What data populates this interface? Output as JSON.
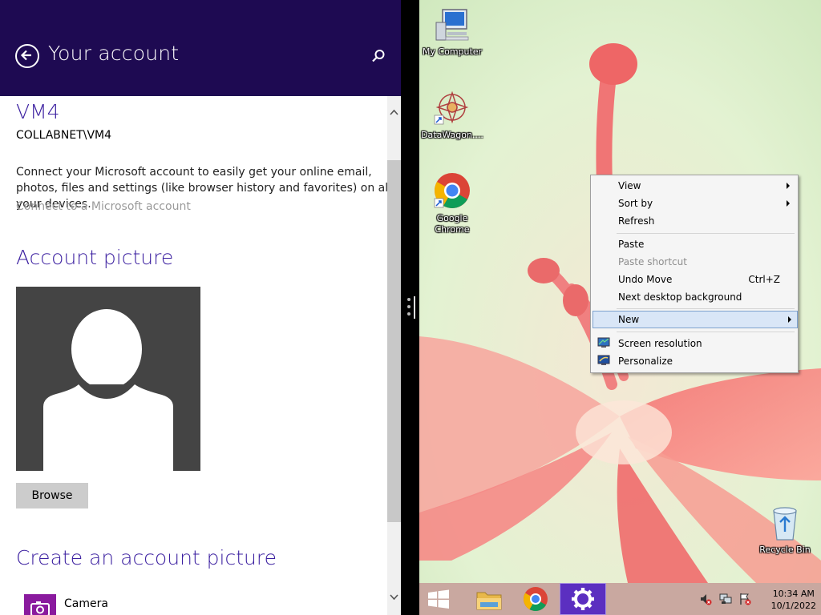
{
  "settings": {
    "title": "Your account",
    "user": {
      "name": "VM4",
      "domain": "COLLABNET\\VM4"
    },
    "description": "Connect your Microsoft account to easily get your online email, photos, files and settings (like browser history and favorites) on all your devices.",
    "connect_link": "Connect to a Microsoft account",
    "account_picture_heading": "Account picture",
    "browse_label": "Browse",
    "create_heading": "Create an account picture",
    "camera_label": "Camera",
    "accent": "#1e0a52",
    "heading_color": "#3b1fa0"
  },
  "desktop": {
    "icons": [
      {
        "label": "My Computer",
        "icon": "computer-icon"
      },
      {
        "label": "DataWagon....",
        "icon": "datawagon-shortcut-icon"
      },
      {
        "label": "Google Chrome",
        "icon": "chrome-shortcut-icon"
      },
      {
        "label": "Recycle Bin",
        "icon": "recycle-bin-icon"
      }
    ],
    "context_menu": {
      "view": "View",
      "sort_by": "Sort by",
      "refresh": "Refresh",
      "paste": "Paste",
      "paste_shortcut": "Paste shortcut",
      "undo_move": "Undo Move",
      "undo_shortcut": "Ctrl+Z",
      "next_background": "Next desktop background",
      "new": "New",
      "screen_resolution": "Screen resolution",
      "personalize": "Personalize"
    }
  },
  "taskbar": {
    "items": [
      "start-icon",
      "file-explorer-icon",
      "chrome-icon",
      "settings-icon"
    ],
    "tray_icons": [
      "volume-muted-icon",
      "network-icon",
      "action-center-flag-icon"
    ],
    "time": "10:34 AM",
    "date": "10/1/2022"
  }
}
